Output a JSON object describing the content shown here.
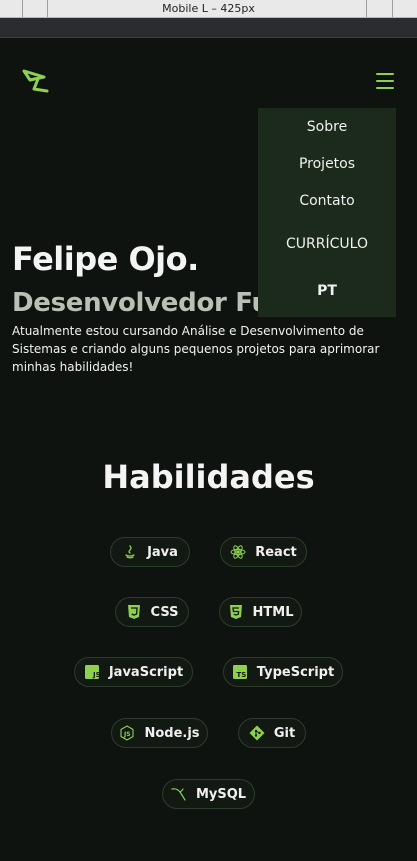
{
  "devtools": {
    "viewport_label": "Mobile L – 425px"
  },
  "nav": {
    "menu_items": [
      "Sobre",
      "Projetos",
      "Contato",
      "CURRÍCULO",
      "PT"
    ]
  },
  "hero": {
    "name": "Felipe Ojo.",
    "role": "Desenvolvedor Full",
    "description": "Atualmente estou cursando Análise e Desenvolvimento de Sistemas e criando alguns pequenos projetos para aprimorar minhas habilidades!"
  },
  "skills": {
    "title": "Habilidades",
    "items": [
      {
        "label": "Java",
        "icon": "java-icon"
      },
      {
        "label": "React",
        "icon": "react-icon"
      },
      {
        "label": "CSS",
        "icon": "css-icon"
      },
      {
        "label": "HTML",
        "icon": "html-icon"
      },
      {
        "label": "JavaScript",
        "icon": "javascript-icon"
      },
      {
        "label": "TypeScript",
        "icon": "typescript-icon"
      },
      {
        "label": "Node.js",
        "icon": "nodejs-icon"
      },
      {
        "label": "Git",
        "icon": "git-icon"
      },
      {
        "label": "MySQL",
        "icon": "mysql-icon"
      }
    ]
  },
  "colors": {
    "background": "#0f130f",
    "accent": "#8fd14f",
    "dropdown_bg": "#1c2a1c",
    "chip_border": "#2d3d2b",
    "subtitle": "#b9c0b6"
  }
}
